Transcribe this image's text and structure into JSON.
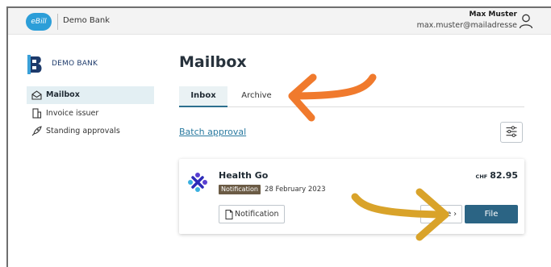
{
  "header": {
    "app_logo": "eBill",
    "bank_name": "Demo Bank",
    "user_name": "Max Muster",
    "user_email": "max.muster@mailadresse",
    "user_icon": "user-icon"
  },
  "sidebar": {
    "brand": "DEMO BANK",
    "items": [
      {
        "label": "Mailbox",
        "icon": "mailbox-icon",
        "active": true
      },
      {
        "label": "Invoice issuer",
        "icon": "building-icon",
        "active": false
      },
      {
        "label": "Standing approvals",
        "icon": "rocket-icon",
        "active": false
      }
    ]
  },
  "main": {
    "title": "Mailbox",
    "tabs": [
      {
        "label": "Inbox",
        "active": true
      },
      {
        "label": "Archive",
        "active": false
      }
    ],
    "batch_approval": "Batch approval",
    "filter_icon": "filter-icon",
    "card": {
      "title": "Health Go",
      "badge": "Notification",
      "date": "28 February 2023",
      "currency": "CHF",
      "amount": "82.95",
      "notification_button": "Notification",
      "more_button": "e ›",
      "file_button": "File"
    }
  },
  "colors": {
    "accent": "#2b6484",
    "link": "#2a7aa0",
    "arrow_orange": "#f07a2d",
    "arrow_gold": "#d9a32a",
    "badge": "#6b5b45",
    "ebill_blue": "#2c9ed8"
  }
}
